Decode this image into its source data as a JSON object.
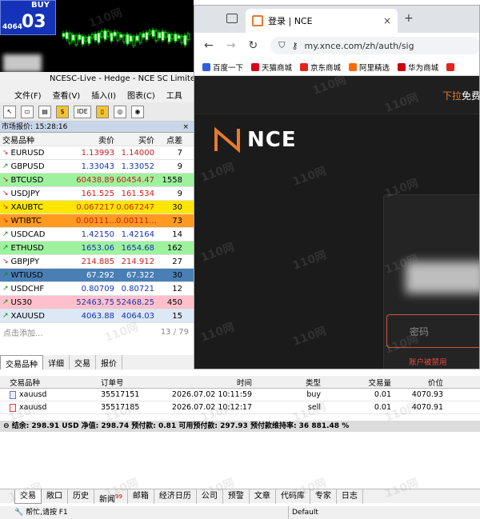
{
  "chart": {
    "buy_label": "BUY",
    "price_big": "03",
    "price_small": "4064"
  },
  "title_bar": {
    "text": "NCESC-Live - Hedge - NCE SC Limited"
  },
  "menu": [
    "文件(F)",
    "查看(V)",
    "插入(I)",
    "图表(C)",
    "工具"
  ],
  "market_watch": {
    "title": "市场报价: 15:28:16",
    "headers": [
      "交易品种",
      "卖价",
      "买价",
      "点差"
    ],
    "rows": [
      {
        "symbol": "EURUSD",
        "bid": "1.13993",
        "ask": "1.14000",
        "spread": "7",
        "dir": "down",
        "bg": "#ffffff"
      },
      {
        "symbol": "GBPUSD",
        "bid": "1.33043",
        "ask": "1.33052",
        "spread": "9",
        "dir": "up",
        "bg": "#ffffff"
      },
      {
        "symbol": "BTCUSD",
        "bid": "60438.89",
        "ask": "60454.47",
        "spread": "1558",
        "dir": "down",
        "bg": "#9ef29e"
      },
      {
        "symbol": "USDJPY",
        "bid": "161.525",
        "ask": "161.534",
        "spread": "9",
        "dir": "down",
        "bg": "#ffffff"
      },
      {
        "symbol": "XAUBTC",
        "bid": "0.067217",
        "ask": "0.067247",
        "spread": "30",
        "dir": "down",
        "bg": "#ffe600"
      },
      {
        "symbol": "WTIBTC",
        "bid": "0.00111...",
        "ask": "0.00111...",
        "spread": "73",
        "dir": "down",
        "bg": "#ff9a1f"
      },
      {
        "symbol": "USDCAD",
        "bid": "1.42150",
        "ask": "1.42164",
        "spread": "14",
        "dir": "up",
        "bg": "#ffffff"
      },
      {
        "symbol": "ETHUSD",
        "bid": "1653.06",
        "ask": "1654.68",
        "spread": "162",
        "dir": "up",
        "bg": "#9ef29e"
      },
      {
        "symbol": "GBPJPY",
        "bid": "214.885",
        "ask": "214.912",
        "spread": "27",
        "dir": "down",
        "bg": "#ffffff"
      },
      {
        "symbol": "WTIUSD",
        "bid": "67.292",
        "ask": "67.322",
        "spread": "30",
        "dir": "up",
        "bg": "#4a7fb5"
      },
      {
        "symbol": "USDCHF",
        "bid": "0.80709",
        "ask": "0.80721",
        "spread": "12",
        "dir": "up",
        "bg": "#ffffff"
      },
      {
        "symbol": "US30",
        "bid": "52463.75",
        "ask": "52468.25",
        "spread": "450",
        "dir": "up",
        "bg": "#ffc0cb"
      },
      {
        "symbol": "XAUUSD",
        "bid": "4063.88",
        "ask": "4064.03",
        "spread": "15",
        "dir": "up",
        "bg": "#dde8f6"
      }
    ],
    "add_label": "点击添加...",
    "count": "13 / 79",
    "tabs": [
      "交易品种",
      "详细",
      "交易",
      "报价"
    ]
  },
  "orders": {
    "headers": [
      "交易品种",
      "订单号",
      "时间",
      "类型",
      "交易量",
      "价位"
    ],
    "rows": [
      {
        "symbol": "xauusd",
        "order": "35517151",
        "time": "2026.07.02 10:11:59",
        "type": "buy",
        "volume": "0.01",
        "price": "4070.93"
      },
      {
        "symbol": "xauusd",
        "order": "35517185",
        "time": "2026.07.02 10:12:17",
        "type": "sell",
        "volume": "0.01",
        "price": "4070.91"
      }
    ],
    "summary": "结余: 298.91 USD  净值: 298.74  预付款: 0.81  可用预付款: 297.93  预付款维持率: 36 881.48 %"
  },
  "bottom_tabs": [
    {
      "label": "交易",
      "badge": ""
    },
    {
      "label": "敞口",
      "badge": ""
    },
    {
      "label": "历史",
      "badge": ""
    },
    {
      "label": "新闻",
      "badge": "99"
    },
    {
      "label": "邮箱",
      "badge": ""
    },
    {
      "label": "经济日历",
      "badge": ""
    },
    {
      "label": "公司",
      "badge": ""
    },
    {
      "label": "预警",
      "badge": ""
    },
    {
      "label": "文章",
      "badge": ""
    },
    {
      "label": "代码库",
      "badge": ""
    },
    {
      "label": "专家",
      "badge": ""
    },
    {
      "label": "日志",
      "badge": ""
    }
  ],
  "status": {
    "help": "帮忙,请按 F1",
    "profile": "Default"
  },
  "browser": {
    "tab_title": "登录 | NCE",
    "url": "my.xnce.com/zh/auth/sig",
    "bookmarks": [
      {
        "label": "百度一下",
        "color": "#2f5fe0"
      },
      {
        "label": "天猫商城",
        "color": "#d8001b"
      },
      {
        "label": "京东商城",
        "color": "#e1251b"
      },
      {
        "label": "阿里精选",
        "color": "#ff6a00"
      },
      {
        "label": "华为商城",
        "color": "#c7000b"
      },
      {
        "label": "",
        "color": "#e1251b"
      }
    ],
    "page": {
      "pull_label": "下拉",
      "free_label": "免费",
      "logo_text": "NCE",
      "password_placeholder": "密码",
      "error_text": "账户被禁用"
    }
  },
  "watermark": "110网",
  "colors": {
    "accent": "#e87a2c",
    "buy_box": "#1533b8",
    "error": "#e4473e"
  }
}
